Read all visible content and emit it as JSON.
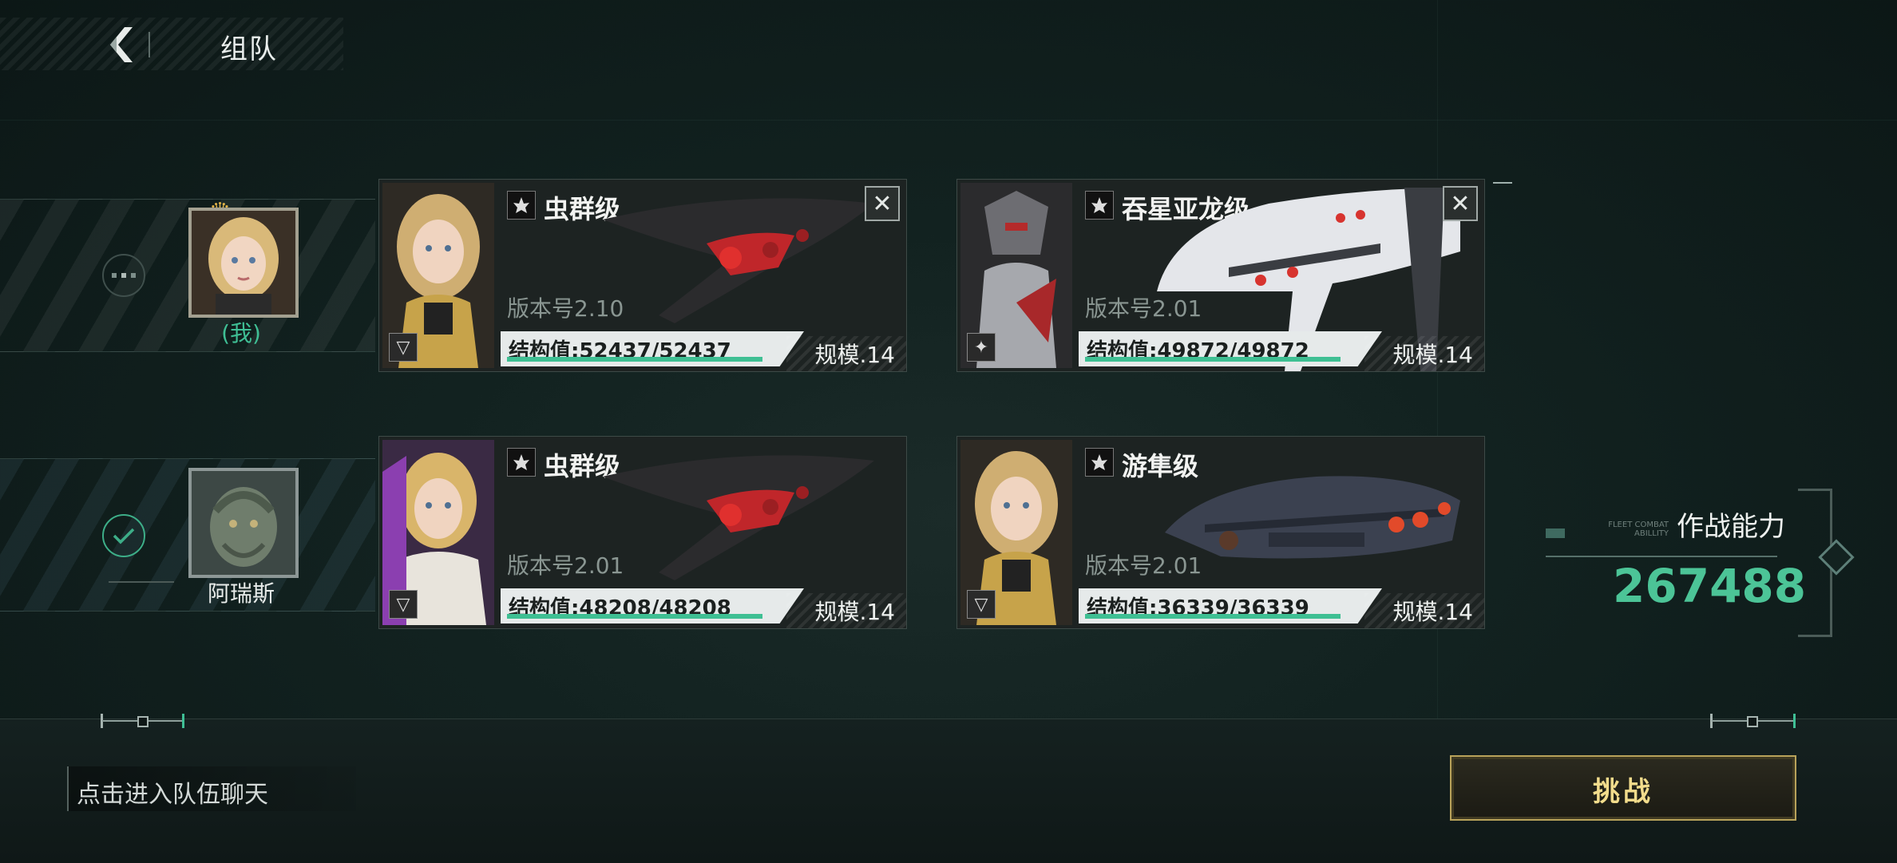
{
  "header": {
    "title": "组队",
    "back_icon": "back-arrow-icon"
  },
  "players": [
    {
      "name": "(我)",
      "status": "leader",
      "status_icon": "dots-icon",
      "crown_icon": "crown-icon"
    },
    {
      "name": "阿瑞斯",
      "status": "ready",
      "status_icon": "check-icon"
    }
  ],
  "ships": [
    {
      "class_name": "虫群级",
      "version": "版本号2.10",
      "structure": "结构值:52437/52437",
      "structure_ratio": 1.0,
      "scale": "规模.14",
      "removable": true,
      "class_icon": "faction-icon"
    },
    {
      "class_name": "吞星亚龙级",
      "version": "版本号2.01",
      "structure": "结构值:49872/49872",
      "structure_ratio": 1.0,
      "scale": "规模.14",
      "removable": true,
      "class_icon": "faction-icon"
    },
    {
      "class_name": "虫群级",
      "version": "版本号2.01",
      "structure": "结构值:48208/48208",
      "structure_ratio": 1.0,
      "scale": "规模.14",
      "removable": false,
      "class_icon": "faction-icon"
    },
    {
      "class_name": "游隼级",
      "version": "版本号2.01",
      "structure": "结构值:36339/36339",
      "structure_ratio": 1.0,
      "scale": "规模.14",
      "removable": false,
      "class_icon": "faction-icon"
    }
  ],
  "combat": {
    "label": "作战能力",
    "value": "267488",
    "small_label": "FLEET COMBAT ABILLITY"
  },
  "chat": {
    "placeholder": "点击进入队伍聊天"
  },
  "challenge": {
    "label": "挑战"
  },
  "colors": {
    "accent_green": "#4cc497",
    "gold": "#f2dc8c"
  }
}
